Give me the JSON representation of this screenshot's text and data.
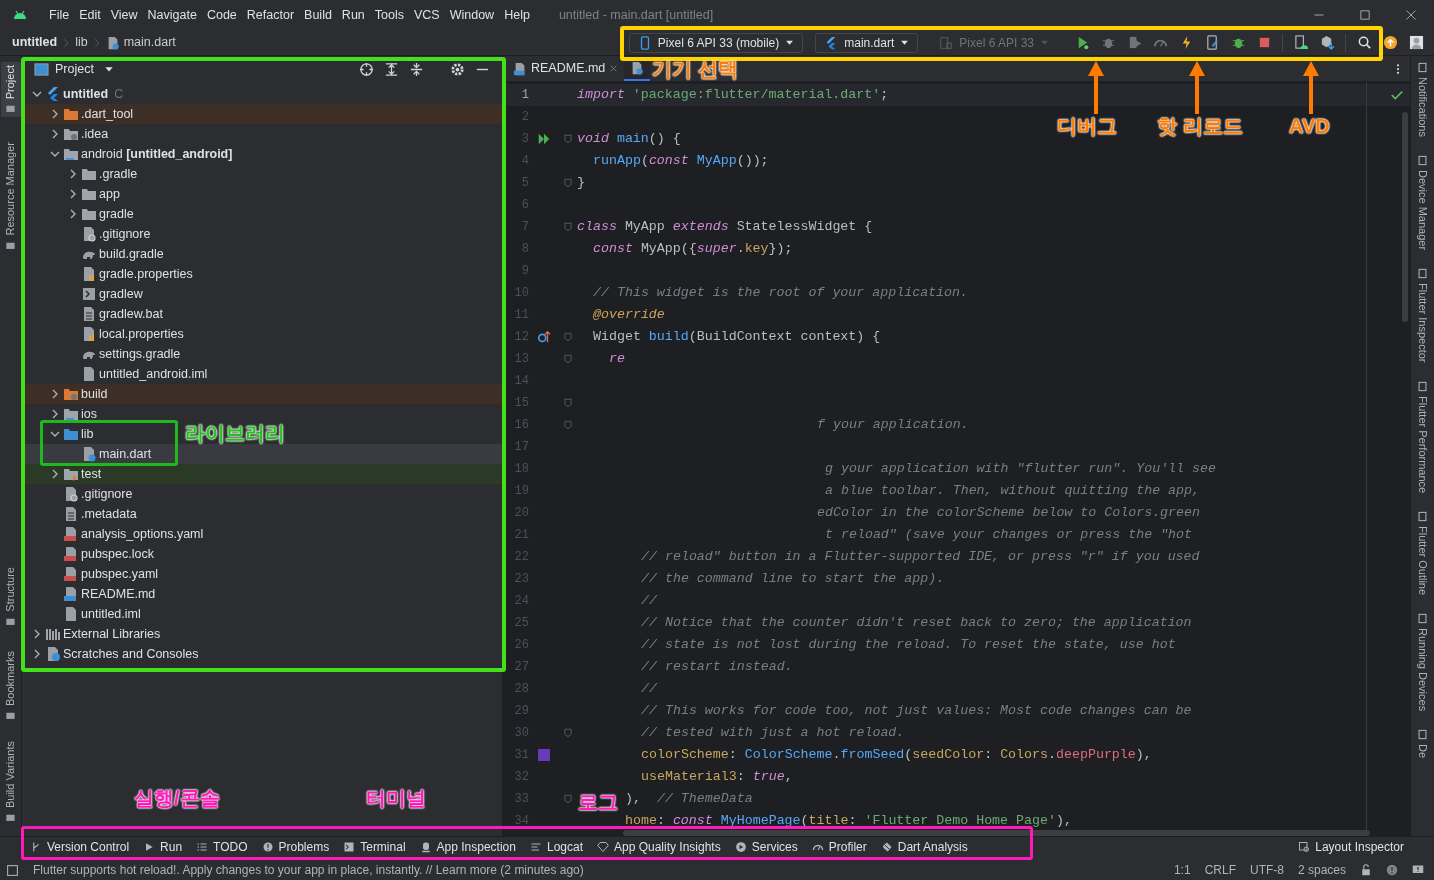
{
  "window": {
    "title": "untitled - main.dart [untitled]"
  },
  "menu": [
    "File",
    "Edit",
    "View",
    "Navigate",
    "Code",
    "Refactor",
    "Build",
    "Run",
    "Tools",
    "VCS",
    "Window",
    "Help"
  ],
  "breadcrumb": [
    "untitled",
    "lib",
    "main.dart"
  ],
  "toolbar": {
    "device": "Pixel 6 API 33 (mobile)",
    "config": "main.dart",
    "target": "Pixel 6 API 33",
    "target_disabled": true
  },
  "left_stripe": [
    {
      "label": "Project",
      "selected": true
    },
    {
      "label": "Resource Manager",
      "selected": false
    },
    {
      "label": "Structure",
      "selected": false
    },
    {
      "label": "Bookmarks",
      "selected": false
    },
    {
      "label": "Build Variants",
      "selected": false
    }
  ],
  "right_stripe": [
    "Notifications",
    "Device Manager",
    "Flutter Inspector",
    "Flutter Performance",
    "Flutter Outline",
    "Running Devices",
    "De"
  ],
  "project": {
    "title": "Project",
    "tree": [
      {
        "label": "untitled",
        "path": "C",
        "kind": "flutter",
        "expanded": true,
        "excluded": false,
        "selected": false,
        "children": [
          {
            "label": ".dart_tool",
            "kind": "folder-orange",
            "expanded": false,
            "excluded": true,
            "selected": false
          },
          {
            "label": ".idea",
            "kind": "folder-gear",
            "expanded": false,
            "excluded": false,
            "selected": false
          },
          {
            "label": "android",
            "suffix": "[untitled_android]",
            "kind": "folder-module",
            "expanded": true,
            "excluded": false,
            "selected": false,
            "children": [
              {
                "label": ".gradle",
                "kind": "folder",
                "expanded": false,
                "excluded": false,
                "selected": false
              },
              {
                "label": "app",
                "kind": "folder",
                "expanded": false,
                "excluded": false,
                "selected": false
              },
              {
                "label": "gradle",
                "kind": "folder",
                "expanded": false,
                "excluded": false,
                "selected": false
              },
              {
                "label": ".gitignore",
                "kind": "ignore",
                "excluded": false,
                "selected": false
              },
              {
                "label": "build.gradle",
                "kind": "gradle",
                "excluded": false,
                "selected": false
              },
              {
                "label": "gradle.properties",
                "kind": "properties",
                "excluded": false,
                "selected": false
              },
              {
                "label": "gradlew",
                "kind": "shell",
                "excluded": false,
                "selected": false
              },
              {
                "label": "gradlew.bat",
                "kind": "text",
                "excluded": false,
                "selected": false
              },
              {
                "label": "local.properties",
                "kind": "properties",
                "excluded": false,
                "selected": false
              },
              {
                "label": "settings.gradle",
                "kind": "gradle",
                "excluded": false,
                "selected": false
              },
              {
                "label": "untitled_android.iml",
                "kind": "iml",
                "excluded": false,
                "selected": false
              }
            ]
          },
          {
            "label": "build",
            "kind": "folder-orange-gear",
            "expanded": false,
            "excluded": true,
            "selected": false
          },
          {
            "label": "ios",
            "kind": "folder-module",
            "expanded": false,
            "excluded": false,
            "selected": false
          },
          {
            "label": "lib",
            "kind": "folder-blue",
            "expanded": true,
            "excluded": false,
            "selected": false,
            "children": [
              {
                "label": "main.dart",
                "kind": "dart",
                "excluded": false,
                "selected": true
              }
            ]
          },
          {
            "label": "test",
            "kind": "folder-test",
            "expanded": false,
            "excluded": false,
            "selected": false
          },
          {
            "label": ".gitignore",
            "kind": "ignore",
            "excluded": false,
            "selected": false
          },
          {
            "label": ".metadata",
            "kind": "text",
            "excluded": false,
            "selected": false
          },
          {
            "label": "analysis_options.yaml",
            "kind": "yaml",
            "excluded": false,
            "selected": false
          },
          {
            "label": "pubspec.lock",
            "kind": "yaml",
            "excluded": false,
            "selected": false
          },
          {
            "label": "pubspec.yaml",
            "kind": "yaml",
            "excluded": false,
            "selected": false
          },
          {
            "label": "README.md",
            "kind": "md",
            "excluded": false,
            "selected": false
          },
          {
            "label": "untitled.iml",
            "kind": "iml",
            "excluded": false,
            "selected": false
          }
        ]
      },
      {
        "label": "External Libraries",
        "kind": "libraries",
        "expanded": false,
        "excluded": false,
        "selected": false
      },
      {
        "label": "Scratches and Consoles",
        "kind": "scratches",
        "expanded": false,
        "excluded": false,
        "selected": false
      }
    ]
  },
  "editor_tabs": [
    {
      "label": "README.md",
      "kind": "md",
      "selected": false
    },
    {
      "kind": "dart",
      "selected": true
    }
  ],
  "code": [
    {
      "n": "1",
      "current": true,
      "fold": false,
      "t": [
        {
          "kind": "k",
          "text": "import "
        },
        {
          "kind": "s",
          "text": "'package:flutter/material.dart'"
        },
        {
          "kind": "p",
          "text": ";"
        }
      ]
    },
    {
      "n": "2",
      "current": false,
      "fold": false
    },
    {
      "n": "3",
      "current": false,
      "fold": true,
      "kind": "run",
      "t": [
        {
          "kind": "k",
          "text": "void "
        },
        {
          "kind": "f",
          "text": "main"
        },
        {
          "kind": "p",
          "text": "() {"
        }
      ]
    },
    {
      "n": "4",
      "current": false,
      "fold": false,
      "t": [
        {
          "kind": "f",
          "text": "  runApp"
        },
        {
          "kind": "p",
          "text": "("
        },
        {
          "kind": "k",
          "text": "const "
        },
        {
          "kind": "f",
          "text": "MyApp"
        },
        {
          "kind": "p",
          "text": "());"
        }
      ]
    },
    {
      "n": "5",
      "current": false,
      "fold": true,
      "t": [
        {
          "kind": "p",
          "text": "}"
        }
      ]
    },
    {
      "n": "6",
      "current": false,
      "fold": false
    },
    {
      "n": "7",
      "current": false,
      "fold": true,
      "t": [
        {
          "kind": "k",
          "text": "class "
        },
        {
          "kind": "p",
          "text": "MyApp "
        },
        {
          "kind": "k",
          "text": "extends "
        },
        {
          "kind": "p",
          "text": "StatelessWidget {"
        }
      ]
    },
    {
      "n": "8",
      "current": false,
      "fold": false,
      "t": [
        {
          "kind": "k",
          "text": "  const "
        },
        {
          "kind": "p",
          "text": "MyApp({"
        },
        {
          "kind": "k",
          "text": "super"
        },
        {
          "kind": "p",
          "text": "."
        },
        {
          "kind": "n",
          "text": "key"
        },
        {
          "kind": "p",
          "text": "});"
        }
      ]
    },
    {
      "n": "9",
      "current": false,
      "fold": false
    },
    {
      "n": "10",
      "current": false,
      "fold": false,
      "t": [
        {
          "kind": "c",
          "text": "  // This widget is the root of your application."
        }
      ]
    },
    {
      "n": "11",
      "current": false,
      "fold": false,
      "t": [
        {
          "kind": "a",
          "text": "  @override"
        }
      ]
    },
    {
      "n": "12",
      "current": false,
      "fold": true,
      "kind": "override",
      "t": [
        {
          "kind": "p",
          "text": "  Widget "
        },
        {
          "kind": "f",
          "text": "build"
        },
        {
          "kind": "p",
          "text": "(BuildContext context) {"
        }
      ]
    },
    {
      "n": "13",
      "current": false,
      "fold": true,
      "t": [
        {
          "kind": "k",
          "text": "    re"
        }
      ]
    },
    {
      "n": "14",
      "current": false,
      "fold": false
    },
    {
      "n": "15",
      "current": false,
      "fold": true
    },
    {
      "n": "16",
      "current": false,
      "fold": true,
      "t": [
        {
          "kind": "c",
          "text": "                              f your application."
        }
      ]
    },
    {
      "n": "17",
      "current": false,
      "fold": false
    },
    {
      "n": "18",
      "current": false,
      "fold": false,
      "t": [
        {
          "kind": "c",
          "text": "                               g your application with \"flutter run\". You'll see"
        }
      ]
    },
    {
      "n": "19",
      "current": false,
      "fold": false,
      "t": [
        {
          "kind": "c",
          "text": "                               a blue toolbar. Then, without quitting the app,"
        }
      ]
    },
    {
      "n": "20",
      "current": false,
      "fold": false,
      "t": [
        {
          "kind": "c",
          "text": "                              edColor in the colorScheme below to Colors.green"
        }
      ]
    },
    {
      "n": "21",
      "current": false,
      "fold": false,
      "t": [
        {
          "kind": "c",
          "text": "                               t reload\" (save your changes or press the \"hot"
        }
      ]
    },
    {
      "n": "22",
      "current": false,
      "fold": false,
      "t": [
        {
          "kind": "c",
          "text": "        // reload\" button in a Flutter-supported IDE, or press \"r\" if you used"
        }
      ]
    },
    {
      "n": "23",
      "current": false,
      "fold": false,
      "t": [
        {
          "kind": "c",
          "text": "        // the command line to start the app)."
        }
      ]
    },
    {
      "n": "24",
      "current": false,
      "fold": false,
      "t": [
        {
          "kind": "c",
          "text": "        //"
        }
      ]
    },
    {
      "n": "25",
      "current": false,
      "fold": false,
      "t": [
        {
          "kind": "c",
          "text": "        // Notice that the counter didn't reset back to zero; the application"
        }
      ]
    },
    {
      "n": "26",
      "current": false,
      "fold": false,
      "t": [
        {
          "kind": "c",
          "text": "        // state is not lost during the reload. To reset the state, use hot"
        }
      ]
    },
    {
      "n": "27",
      "current": false,
      "fold": false,
      "t": [
        {
          "kind": "c",
          "text": "        // restart instead."
        }
      ]
    },
    {
      "n": "28",
      "current": false,
      "fold": false,
      "t": [
        {
          "kind": "c",
          "text": "        //"
        }
      ]
    },
    {
      "n": "29",
      "current": false,
      "fold": false,
      "t": [
        {
          "kind": "c",
          "text": "        // This works for code too, not just values: Most code changes can be"
        }
      ]
    },
    {
      "n": "30",
      "current": false,
      "fold": true,
      "t": [
        {
          "kind": "c",
          "text": "        // tested with just a hot reload."
        }
      ]
    },
    {
      "n": "31",
      "current": false,
      "fold": false,
      "kind": "color",
      "color": "#673ab7",
      "t": [
        {
          "kind": "n",
          "text": "        colorScheme"
        },
        {
          "kind": "p",
          "text": ": "
        },
        {
          "kind": "f",
          "text": "ColorScheme"
        },
        {
          "kind": "p",
          "text": "."
        },
        {
          "kind": "f",
          "text": "fromSeed"
        },
        {
          "kind": "p",
          "text": "("
        },
        {
          "kind": "n",
          "text": "seedColor"
        },
        {
          "kind": "p",
          "text": ": "
        },
        {
          "kind": "n",
          "text": "Colors"
        },
        {
          "kind": "p",
          "text": "."
        },
        {
          "kind": "r",
          "text": "deepPurple"
        },
        {
          "kind": "p",
          "text": "),"
        }
      ]
    },
    {
      "n": "32",
      "current": false,
      "fold": false,
      "t": [
        {
          "kind": "n",
          "text": "        useMaterial3"
        },
        {
          "kind": "p",
          "text": ": "
        },
        {
          "kind": "k",
          "text": "true"
        },
        {
          "kind": "p",
          "text": ","
        }
      ]
    },
    {
      "n": "33",
      "current": false,
      "fold": true,
      "t": [
        {
          "kind": "p",
          "text": "      ),  "
        },
        {
          "kind": "c",
          "text": "// ThemeData"
        }
      ]
    },
    {
      "n": "34",
      "current": false,
      "fold": false,
      "t": [
        {
          "kind": "n",
          "text": "      home"
        },
        {
          "kind": "p",
          "text": ": "
        },
        {
          "kind": "k",
          "text": "const "
        },
        {
          "kind": "f",
          "text": "MyHomePage"
        },
        {
          "kind": "p",
          "text": "("
        },
        {
          "kind": "n",
          "text": "title"
        },
        {
          "kind": "p",
          "text": ": "
        },
        {
          "kind": "s",
          "text": "'Flutter Demo Home Page'"
        },
        {
          "kind": "p",
          "text": "),"
        }
      ]
    }
  ],
  "bottom_tools": [
    {
      "label": "Version Control",
      "kind": "branch"
    },
    {
      "label": "Run",
      "kind": "play"
    },
    {
      "label": "TODO",
      "kind": "list"
    },
    {
      "label": "Problems",
      "kind": "alert"
    },
    {
      "label": "Terminal",
      "kind": "terminal"
    },
    {
      "label": "App Inspection",
      "kind": "inspect"
    },
    {
      "label": "Logcat",
      "kind": "lines"
    },
    {
      "label": "App Quality Insights",
      "kind": "diamond"
    },
    {
      "label": "Services",
      "kind": "services"
    },
    {
      "label": "Profiler",
      "kind": "gauge"
    },
    {
      "label": "Dart Analysis",
      "kind": "dart"
    }
  ],
  "bottom_right_tool": "Layout Inspector",
  "status": {
    "message": "Flutter supports hot reload!. Apply changes to your app in place, instantly. // Learn more (2 minutes ago)",
    "position": "1:1",
    "line_ending": "CRLF",
    "encoding": "UTF-8",
    "indent": "2 spaces"
  },
  "annotations": [
    {
      "kind": "frame",
      "color": "#ffd400"
    },
    {
      "kind": "frame",
      "color": "#44e01c"
    },
    {
      "kind": "frame",
      "color": "#1fb81f"
    },
    {
      "kind": "frame",
      "color": "#ff1ab8"
    },
    {
      "kind": "label",
      "text": "기기 선택",
      "color": "#ff7a00"
    },
    {
      "kind": "label",
      "text": "디버그",
      "color": "#ff7a00"
    },
    {
      "kind": "label",
      "text": "핫 리로드",
      "color": "#ff7a00"
    },
    {
      "kind": "label",
      "text": "AVD",
      "color": "#ff7a00"
    },
    {
      "kind": "label",
      "text": "라이브러리",
      "color": "#22c21a"
    },
    {
      "kind": "label",
      "text": "실행/콘솔",
      "color": "#ff1ab8"
    },
    {
      "kind": "label",
      "text": "터미널",
      "color": "#ff1ab8"
    },
    {
      "kind": "label",
      "text": "로그",
      "color": "#ff1ab8"
    },
    {
      "kind": "arrow",
      "color": "#ff7a00"
    },
    {
      "kind": "arrow",
      "color": "#ff7a00"
    },
    {
      "kind": "arrow",
      "color": "#ff7a00"
    }
  ]
}
